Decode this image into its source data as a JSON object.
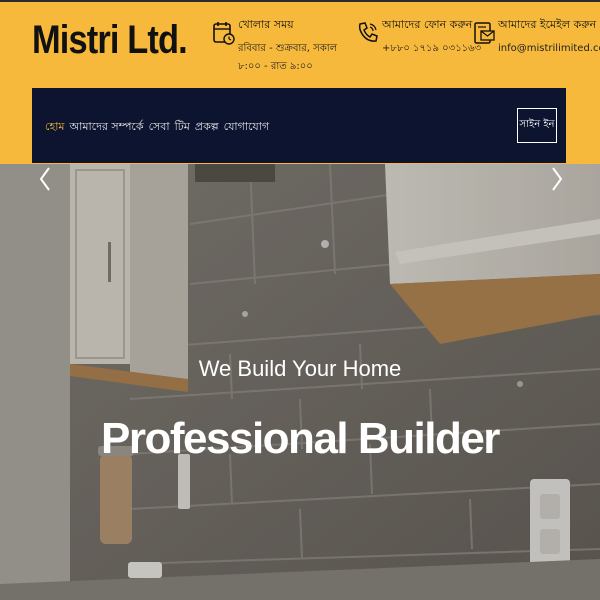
{
  "brand": {
    "logo": "Mistri Ltd."
  },
  "header_info": {
    "hours": {
      "title": "খোলার সময়",
      "detail": "রবিবার - শুক্রবার, সকাল ৮:০০ - রাত ৯:০০"
    },
    "phone": {
      "title": "আমাদের ফোন করুন",
      "detail": "+৮৮০ ১৭১৯ ০৩১১৬৩"
    },
    "email": {
      "title": "আমাদের ইমেইল করুন",
      "detail": "info@mistrilimited.com"
    }
  },
  "nav": {
    "items": [
      {
        "label": "হোম",
        "active": true
      },
      {
        "label": "আমাদের সম্পর্কে"
      },
      {
        "label": "সেবা"
      },
      {
        "label": "টিম"
      },
      {
        "label": "প্রকল্প"
      },
      {
        "label": "যোগাযোগ"
      }
    ],
    "signin_label": "সাইন ইন"
  },
  "hero": {
    "subtitle": "We Build Your Home",
    "headline": "Professional Builder"
  },
  "colors": {
    "accent": "#f6b93b",
    "nav_bg": "#0c1430",
    "text": "#111111"
  },
  "icons": [
    "calendar-clock-icon",
    "phone-hand-icon",
    "email-card-icon",
    "chevron-left-icon",
    "chevron-right-icon"
  ]
}
